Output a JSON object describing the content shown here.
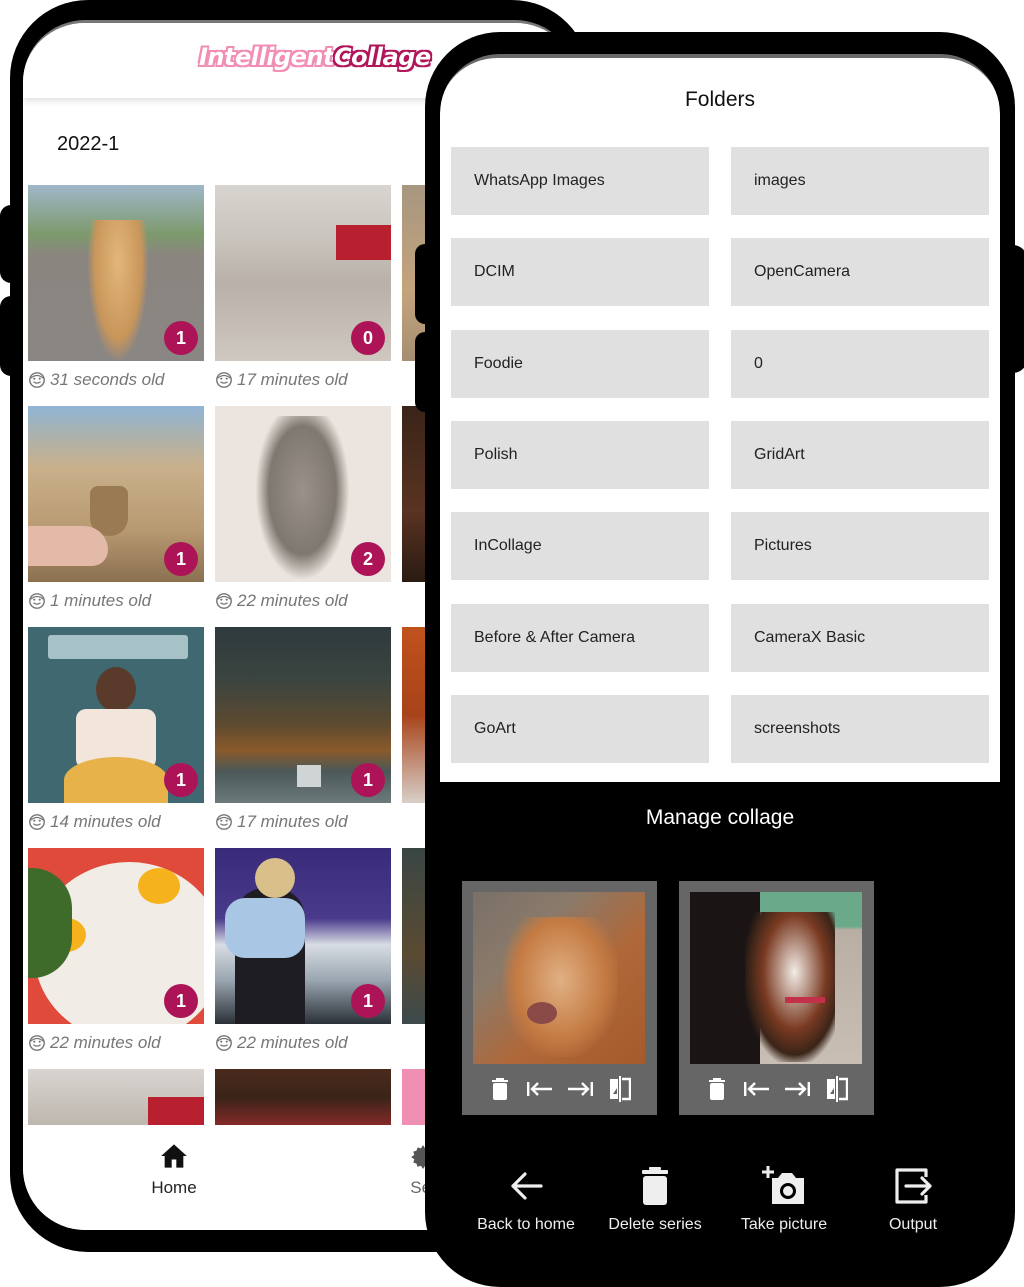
{
  "left_phone": {
    "app_logo": {
      "part1": "Intelligent",
      "part2": "Collage"
    },
    "section_title": "2022-1",
    "colors": {
      "badge": "#ad1457",
      "logo_light": "#f28fb5",
      "logo_dark": "#b0185a"
    },
    "tiles": [
      {
        "image": "golden retriever on brick path",
        "count": "1",
        "age": "31 seconds old"
      },
      {
        "image": "shopping mall interior",
        "count": "0",
        "age": "17 minutes old"
      },
      {
        "image": "tree-lined path",
        "count": "",
        "age": ""
      },
      {
        "image": "Joshua Tree badge among cacti",
        "count": "1",
        "age": "1 minutes old"
      },
      {
        "image": "grey tabby kitten",
        "count": "2",
        "age": "22 minutes old"
      },
      {
        "image": "painting of figures",
        "count": "",
        "age": ""
      },
      {
        "image": "Edmonia Lewis illustration",
        "count": "1",
        "age": "14 minutes old"
      },
      {
        "image": "autumn forest lake",
        "count": "1",
        "age": "17 minutes old"
      },
      {
        "image": "autumn tree in mall",
        "count": "",
        "age": ""
      },
      {
        "image": "fried eggs dish",
        "count": "1",
        "age": "22 minutes old"
      },
      {
        "image": "snooker player with microphone",
        "count": "1",
        "age": "22 minutes old"
      },
      {
        "image": "forest lake",
        "count": "",
        "age": ""
      },
      {
        "image": "mall interior",
        "count": "",
        "age": ""
      },
      {
        "image": "restaurant ceiling",
        "count": "",
        "age": ""
      },
      {
        "image": "pink graphic",
        "count": "",
        "age": ""
      }
    ],
    "bottom_nav": [
      {
        "label": "Home",
        "icon": "home-icon"
      },
      {
        "label": "Set",
        "icon": "gear-icon"
      }
    ]
  },
  "right_phone": {
    "folders_title": "Folders",
    "folders": [
      "WhatsApp Images",
      "images",
      "DCIM",
      "OpenCamera",
      "Foodie",
      "0",
      "Polish",
      "GridArt",
      "InCollage",
      "Pictures",
      "Before & After Camera",
      "CameraX Basic",
      "GoArt",
      "screenshots"
    ],
    "manage_title": "Manage collage",
    "collage_items": [
      {
        "image": "golden retriever close-up"
      },
      {
        "image": "beagle with red harness"
      }
    ],
    "card_actions": [
      "delete-icon",
      "move-left-icon",
      "move-right-icon",
      "flip-icon"
    ],
    "actions": [
      {
        "label": "Back to home",
        "icon": "arrow-left-icon"
      },
      {
        "label": "Delete series",
        "icon": "trash-icon"
      },
      {
        "label": "Take picture",
        "icon": "add-camera-icon"
      },
      {
        "label": "Output",
        "icon": "output-icon"
      }
    ]
  }
}
